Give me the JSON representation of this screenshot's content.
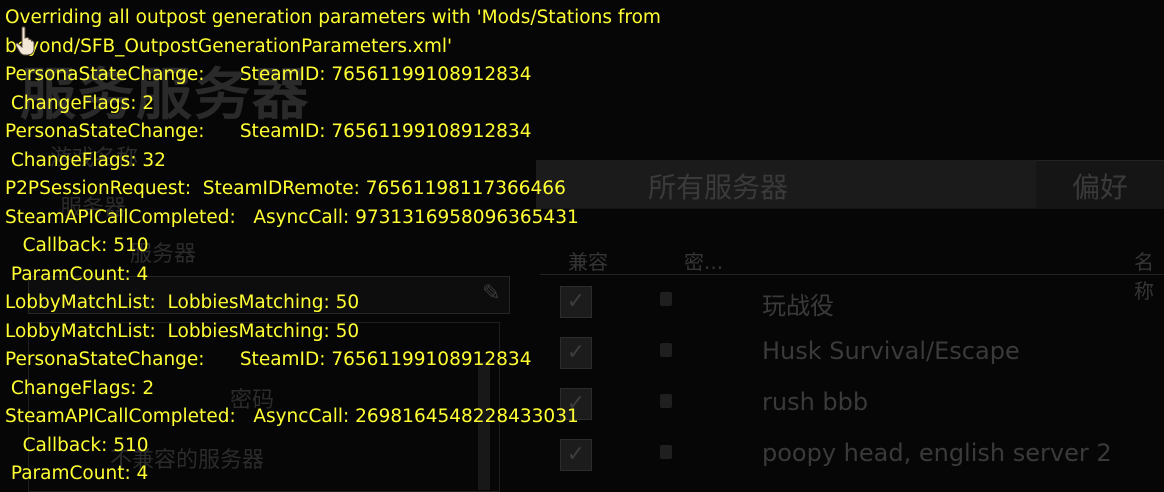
{
  "background": {
    "title": "服务服务器",
    "side_labels": [
      "游戏名称",
      "服务器",
      "服务器",
      "密码",
      "不兼容的服务器"
    ],
    "tabs": [
      "所有服务器",
      "偏好"
    ],
    "columns": [
      "兼容",
      "密...",
      "名称"
    ],
    "servers": [
      {
        "name": "玩战役"
      },
      {
        "name": "Husk Survival/Escape"
      },
      {
        "name": "rush bbb"
      },
      {
        "name": "poopy head, english server 2"
      }
    ]
  },
  "console": {
    "lines": [
      "Overriding all outpost generation parameters with 'Mods/Stations from",
      "beyond/SFB_OutpostGenerationParameters.xml'",
      "PersonaStateChange:      SteamID: 76561199108912834",
      " ChangeFlags: 2",
      "PersonaStateChange:      SteamID: 76561199108912834",
      " ChangeFlags: 32",
      "P2PSessionRequest:  SteamIDRemote: 76561198117366466",
      "SteamAPICallCompleted:   AsyncCall: 9731316958096365431",
      "   Callback: 510",
      " ParamCount: 4",
      "LobbyMatchList:  LobbiesMatching: 50",
      "LobbyMatchList:  LobbiesMatching: 50",
      "PersonaStateChange:      SteamID: 76561199108912834",
      " ChangeFlags: 2",
      "SteamAPICallCompleted:   AsyncCall: 2698164548228433031",
      "   Callback: 510",
      " ParamCount: 4"
    ]
  },
  "colors": {
    "console_text": "#ffff33",
    "background": "#060606"
  },
  "icons": {
    "cursor": "hand-pointer-icon",
    "edit": "pencil-icon",
    "checkbox": "checkmark-icon",
    "lock": "lock-icon"
  }
}
